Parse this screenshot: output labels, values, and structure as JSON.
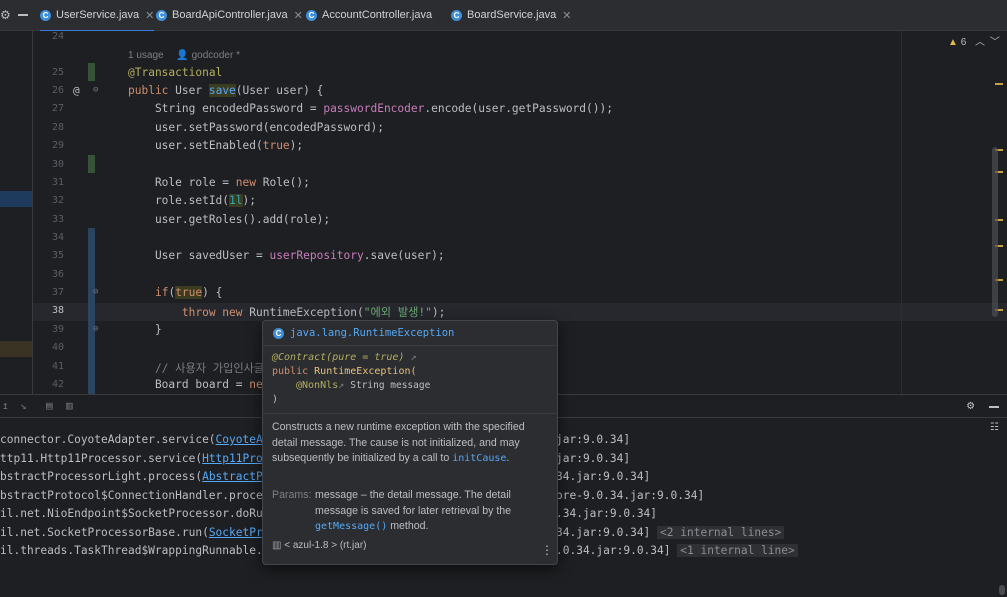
{
  "tabs": [
    {
      "label": "UserService.java",
      "active": true
    },
    {
      "label": "BoardApiController.java",
      "active": false
    },
    {
      "label": "AccountController.java",
      "active": false
    },
    {
      "label": "BoardService.java",
      "active": false
    }
  ],
  "editor": {
    "warnings_count": "6",
    "usage_hint": "1 usage",
    "author_hint": "godcoder *",
    "line_numbers": [
      "24",
      "25",
      "26",
      "27",
      "28",
      "29",
      "30",
      "31",
      "32",
      "33",
      "34",
      "35",
      "36",
      "37",
      "38",
      "39",
      "40",
      "41",
      "42"
    ]
  },
  "popup": {
    "class_name": "java.lang.RuntimeException",
    "contract": "@Contract(pure = true)",
    "sig_public": "public",
    "sig_name": "RuntimeException(",
    "sig_param_ann": "@NonNls",
    "sig_param": "String message",
    "sig_close": ")",
    "description": "Constructs a new runtime exception with the specified detail message. The cause is not initialized, and may subsequently be initialized by a call to",
    "description_link": "initCause",
    "params_label": "Params:",
    "params_text_pre": "message – the detail message. The detail message is saved for later retrieval by the",
    "params_link": "getMessage()",
    "params_text_post": "method.",
    "footer": "< azul-1.8 > (rt.jar)"
  },
  "console": {
    "lines": [
      {
        "pre": "connector.CoyoteAdapter.service(",
        "link": "CoyoteAd",
        "post": "",
        "tail": "jar:9.0.34]",
        "extra": ""
      },
      {
        "pre": "ttp11.Http11Processor.service(",
        "link": "Http11Proce",
        "post": "",
        "tail": "jar:9.0.34]",
        "extra": ""
      },
      {
        "pre": "bstractProcessorLight.process(",
        "link": "AbstractPro",
        "post": "",
        "tail": "34.jar:9.0.34]",
        "extra": ""
      },
      {
        "pre": "bstractProtocol$ConnectionHandler.process(",
        "link": "",
        "post": "",
        "tail": "ore-9.0.34.jar:9.0.34]",
        "extra": ""
      },
      {
        "pre": "il.net.NioEndpoint$SocketProcessor.doRun(",
        "link": "",
        "post": "",
        "tail": ".34.jar:9.0.34]",
        "extra": ""
      },
      {
        "pre": "il.net.SocketProcessorBase.run(",
        "link": "SocketPro",
        "post": "",
        "tail": "34.jar:9.0.34]",
        "extra": "<2 internal lines>"
      },
      {
        "pre": "il.threads.TaskThread$WrappingRunnable.r",
        "link": "",
        "post": "",
        "tail": ".0.34.jar:9.0.34]",
        "extra": "<1 internal line>"
      }
    ]
  },
  "colors": {
    "accent": "#3d7bd8",
    "keyword": "#cf8e6d",
    "string": "#6aab73",
    "method": "#56a8f5"
  }
}
